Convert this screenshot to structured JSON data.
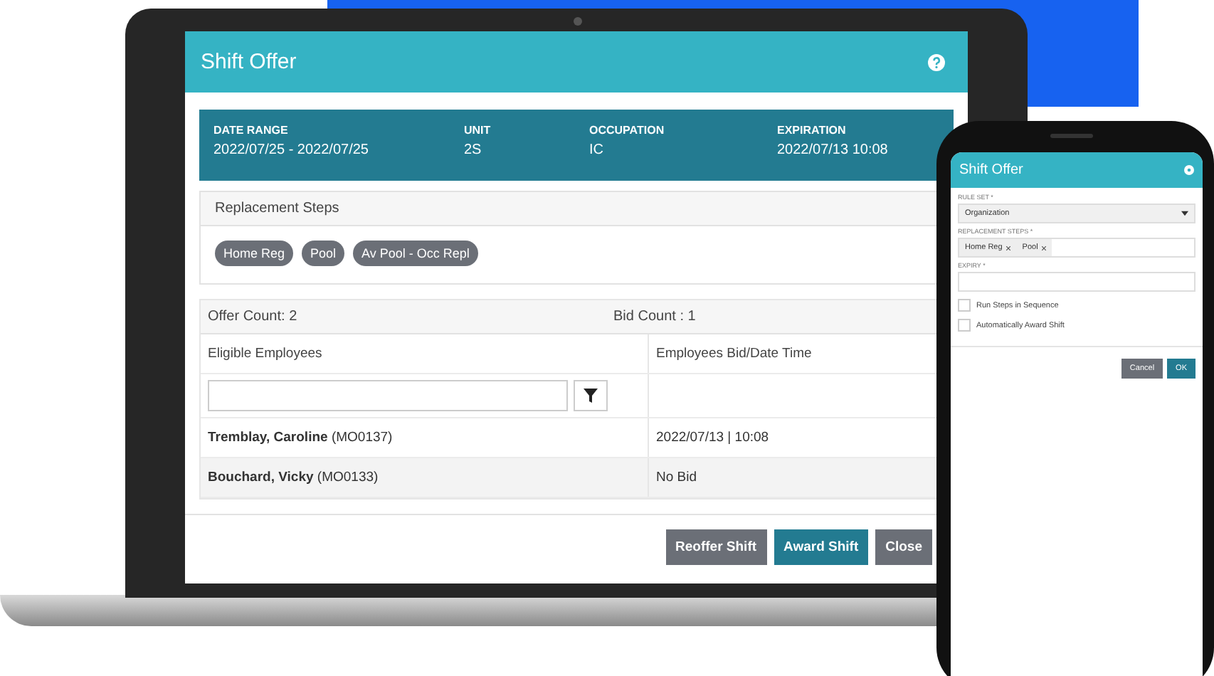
{
  "laptop": {
    "dialog": {
      "title": "Shift Offer",
      "info": [
        {
          "label": "DATE RANGE",
          "value": "2022/07/25 - 2022/07/25"
        },
        {
          "label": "UNIT",
          "value": "2S"
        },
        {
          "label": "OCCUPATION",
          "value": "IC"
        },
        {
          "label": "EXPIRATION",
          "value": "2022/07/13 10:08"
        }
      ],
      "replacement_steps": {
        "title": "Replacement Steps",
        "chips": [
          "Home Reg",
          "Pool",
          "Av Pool - Occ Repl"
        ]
      },
      "offer_count": "Offer Count: 2",
      "bid_count": "Bid Count : 1",
      "table": {
        "columns": [
          "Eligible Employees",
          "Employees Bid/Date Time"
        ],
        "rows": [
          {
            "employee": "**Tremblay, Caroline** (MO0137)",
            "bid": "2022/07/13 | 10:08"
          },
          {
            "employee": "**Bouchard, Vicky** (MO0133)",
            "bid": "No Bid"
          }
        ]
      },
      "buttons": [
        {
          "label": "Reoffer Shift",
          "kind": "secondary"
        },
        {
          "label": "Award Shift",
          "kind": "primary"
        },
        {
          "label": "Close",
          "kind": "secondary"
        }
      ]
    }
  },
  "phone": {
    "dialog": {
      "title": "Shift Offer",
      "fields": [
        {
          "kind": "select",
          "label": "RULE SET *",
          "value": "Organization"
        },
        {
          "kind": "tags",
          "label": "REPLACEMENT STEPS *",
          "tags": [
            "Home Reg",
            "Pool"
          ]
        },
        {
          "kind": "text",
          "label": "EXPIRY *"
        }
      ],
      "checkboxes": [
        {
          "label": "Run Steps in Sequence",
          "checked": false
        },
        {
          "label": "Automatically Award Shift",
          "checked": false
        }
      ],
      "buttons": [
        {
          "label": "Cancel",
          "kind": "secondary"
        },
        {
          "label": "OK",
          "kind": "primary"
        }
      ]
    }
  }
}
